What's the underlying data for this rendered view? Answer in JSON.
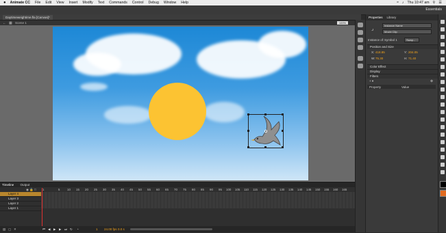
{
  "menubar": {
    "apple": "",
    "items": [
      "Animate CC",
      "File",
      "Edit",
      "View",
      "Insert",
      "Modify",
      "Text",
      "Commands",
      "Control",
      "Debug",
      "Window",
      "Help"
    ],
    "clock": "Thu 10:47 am"
  },
  "workspace": {
    "label": "Essentials"
  },
  "document": {
    "tab": "Daytimeweightime.fla [Canvas]*",
    "scene": "Scene 1",
    "zoom": "100%"
  },
  "properties": {
    "tabs": [
      "Properties",
      "Library"
    ],
    "instance_name_placeholder": "Instance Name",
    "type": "Movie Clip",
    "instance_of_label": "Instance of:",
    "instance_of_value": "Symbol 1",
    "swap_label": "Swap...",
    "sections": [
      "Position and Size",
      "Color Effect",
      "Display",
      "Filters"
    ],
    "x_label": "X:",
    "x_value": "418.85",
    "y_label": "Y:",
    "y_value": "204.05",
    "w_label": "W:",
    "w_value": "75.30",
    "h_label": "H:",
    "h_value": "71.40",
    "filters_headers": [
      "Property",
      "Value"
    ]
  },
  "timeline": {
    "tabs": [
      "Timeline",
      "Output"
    ],
    "layers": [
      "Layer 4",
      "Layer 3",
      "Layer 2",
      "Layer 1"
    ],
    "ruler": [
      "1",
      "5",
      "10",
      "15",
      "20",
      "25",
      "30",
      "35",
      "40",
      "45",
      "50",
      "55",
      "60",
      "65",
      "70",
      "75",
      "80",
      "85",
      "90",
      "95",
      "100",
      "105",
      "110",
      "115",
      "120",
      "125",
      "130",
      "135",
      "140",
      "145",
      "150",
      "155",
      "160",
      "165"
    ],
    "current_frame": "1",
    "fps": "24.00 fps",
    "time": "0.0 s"
  },
  "colors": {
    "sun": "#fcc332",
    "selected_layer": "#b8862d",
    "accent_value": "#f2a31b"
  }
}
